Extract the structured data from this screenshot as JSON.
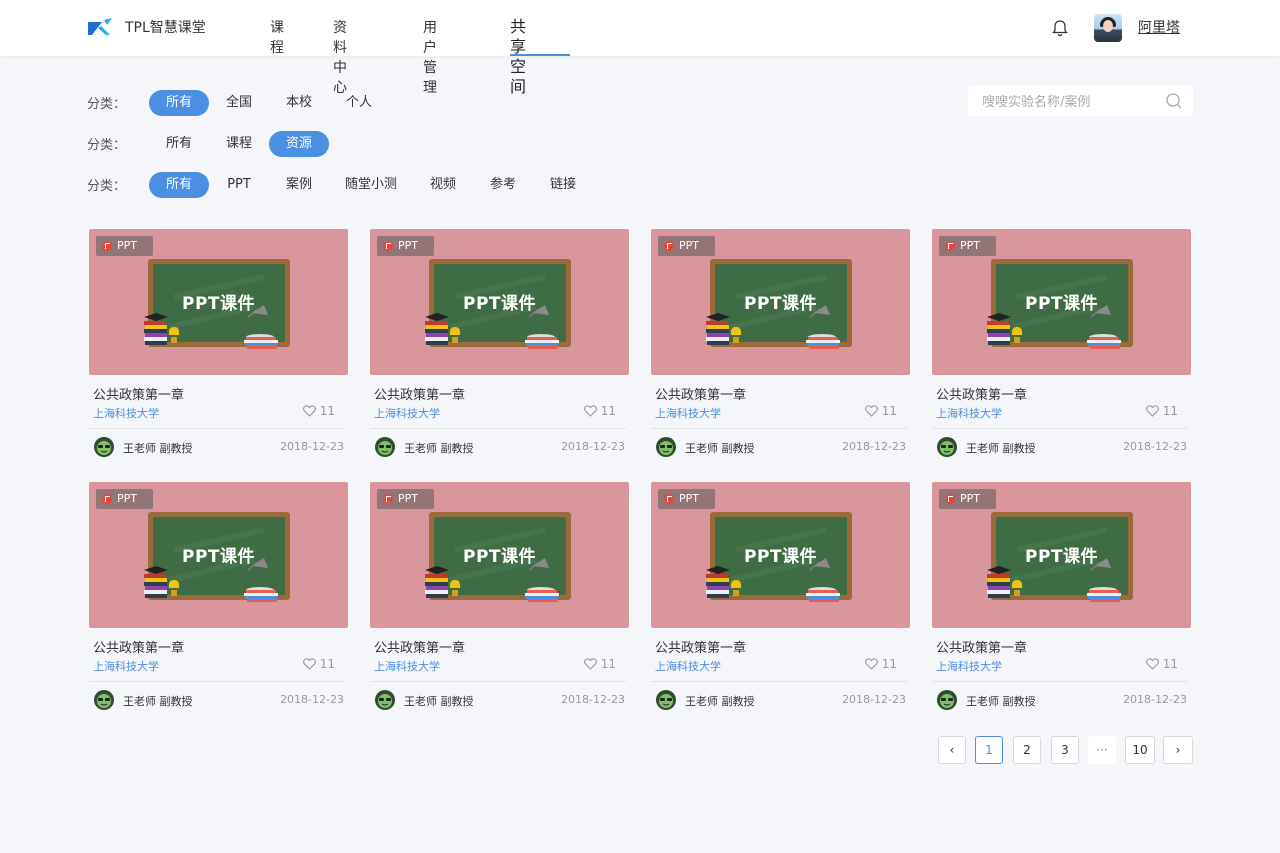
{
  "header": {
    "brand": "TPL智慧课堂",
    "nav": [
      {
        "label": "课程"
      },
      {
        "label": "资料中心"
      },
      {
        "label": "用户管理"
      },
      {
        "label": "共享空间"
      }
    ],
    "active_nav": "共享空间",
    "username": "阿里塔"
  },
  "filters": [
    {
      "label": "分类：",
      "options": [
        "所有",
        "全国",
        "本校",
        "个人"
      ],
      "active": "所有"
    },
    {
      "label": "分类：",
      "options": [
        "所有",
        "课程",
        "资源"
      ],
      "active": "资源"
    },
    {
      "label": "分类：",
      "options": [
        "所有",
        "PPT",
        "案例",
        "随堂小测",
        "视频",
        "参考",
        "链接"
      ],
      "active": "所有"
    }
  ],
  "search": {
    "placeholder": "嗖嗖实验名称/案例"
  },
  "cards": [
    {
      "badge": "PPT",
      "board_text": "PPT课件",
      "title": "公共政策第一章",
      "school": "上海科技大学",
      "likes": "11",
      "teacher": "王老师 副教授",
      "date": "2018-12-23"
    },
    {
      "badge": "PPT",
      "board_text": "PPT课件",
      "title": "公共政策第一章",
      "school": "上海科技大学",
      "likes": "11",
      "teacher": "王老师 副教授",
      "date": "2018-12-23"
    },
    {
      "badge": "PPT",
      "board_text": "PPT课件",
      "title": "公共政策第一章",
      "school": "上海科技大学",
      "likes": "11",
      "teacher": "王老师 副教授",
      "date": "2018-12-23"
    },
    {
      "badge": "PPT",
      "board_text": "PPT课件",
      "title": "公共政策第一章",
      "school": "上海科技大学",
      "likes": "11",
      "teacher": "王老师 副教授",
      "date": "2018-12-23"
    },
    {
      "badge": "PPT",
      "board_text": "PPT课件",
      "title": "公共政策第一章",
      "school": "上海科技大学",
      "likes": "11",
      "teacher": "王老师 副教授",
      "date": "2018-12-23"
    },
    {
      "badge": "PPT",
      "board_text": "PPT课件",
      "title": "公共政策第一章",
      "school": "上海科技大学",
      "likes": "11",
      "teacher": "王老师 副教授",
      "date": "2018-12-23"
    },
    {
      "badge": "PPT",
      "board_text": "PPT课件",
      "title": "公共政策第一章",
      "school": "上海科技大学",
      "likes": "11",
      "teacher": "王老师 副教授",
      "date": "2018-12-23"
    },
    {
      "badge": "PPT",
      "board_text": "PPT课件",
      "title": "公共政策第一章",
      "school": "上海科技大学",
      "likes": "11",
      "teacher": "王老师 副教授",
      "date": "2018-12-23"
    }
  ],
  "pagination": {
    "prev": "‹",
    "pages": [
      "1",
      "2",
      "3",
      "···",
      "10"
    ],
    "current": "1",
    "next": "›"
  },
  "colors": {
    "accent": "#4a8fe2",
    "thumb_bg": "#d9979d",
    "board_green": "#3f6b45",
    "board_frame": "#9b6a3a"
  },
  "icons": [
    "logo-icon",
    "bell-icon",
    "search-icon",
    "ppt-file-icon",
    "heart-icon",
    "teacher-avatar-icon",
    "chevron-left-icon",
    "chevron-right-icon"
  ]
}
